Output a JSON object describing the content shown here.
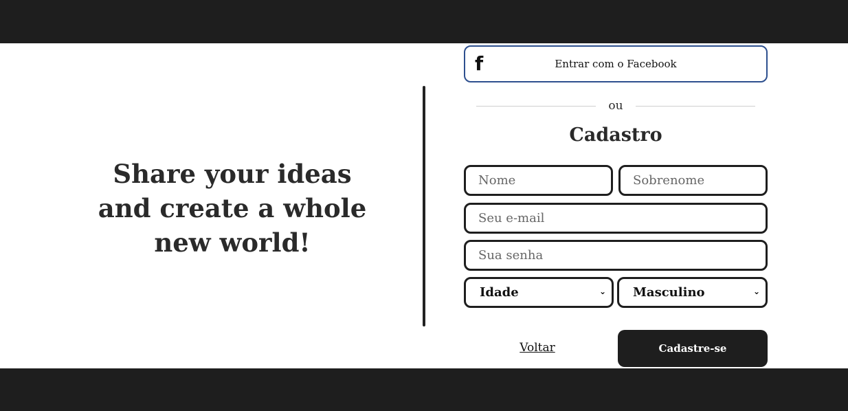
{
  "hero": {
    "tagline": "Share your ideas and create a whole new world!"
  },
  "social": {
    "facebook_label": "Entrar com o Facebook",
    "facebook_icon": "facebook-icon"
  },
  "separator": {
    "text": "ou"
  },
  "form": {
    "title": "Cadastro",
    "fields": {
      "first_name_placeholder": "Nome",
      "last_name_placeholder": "Sobrenome",
      "email_placeholder": "Seu e-mail",
      "password_placeholder": "Sua senha"
    },
    "selects": {
      "age_selected": "Idade",
      "gender_selected": "Masculino"
    },
    "back_label": "Voltar",
    "submit_label": "Cadastre-se"
  },
  "colors": {
    "dark": "#1e1e1e",
    "facebook_border": "#2d4f8e",
    "background": "#ffffff"
  }
}
